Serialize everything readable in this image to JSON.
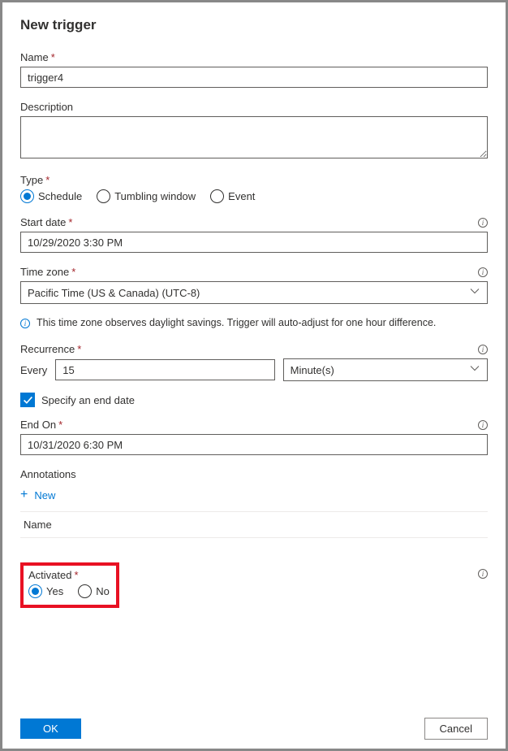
{
  "title": "New trigger",
  "fields": {
    "name": {
      "label": "Name",
      "value": "trigger4"
    },
    "description": {
      "label": "Description",
      "value": ""
    },
    "type": {
      "label": "Type",
      "options": {
        "schedule": "Schedule",
        "tumbling": "Tumbling window",
        "event": "Event"
      },
      "selected": "schedule"
    },
    "startDate": {
      "label": "Start date",
      "value": "10/29/2020 3:30 PM"
    },
    "timeZone": {
      "label": "Time zone",
      "value": "Pacific Time (US & Canada) (UTC-8)"
    },
    "dstNote": "This time zone observes daylight savings. Trigger will auto-adjust for one hour difference.",
    "recurrence": {
      "label": "Recurrence",
      "everyLabel": "Every",
      "everyValue": "15",
      "unitValue": "Minute(s)"
    },
    "specifyEnd": {
      "label": "Specify an end date",
      "checked": true
    },
    "endOn": {
      "label": "End On",
      "value": "10/31/2020 6:30 PM"
    },
    "annotations": {
      "label": "Annotations",
      "newLabel": "New",
      "columnHeader": "Name"
    },
    "activated": {
      "label": "Activated",
      "options": {
        "yes": "Yes",
        "no": "No"
      },
      "selected": "yes"
    }
  },
  "buttons": {
    "ok": "OK",
    "cancel": "Cancel"
  }
}
